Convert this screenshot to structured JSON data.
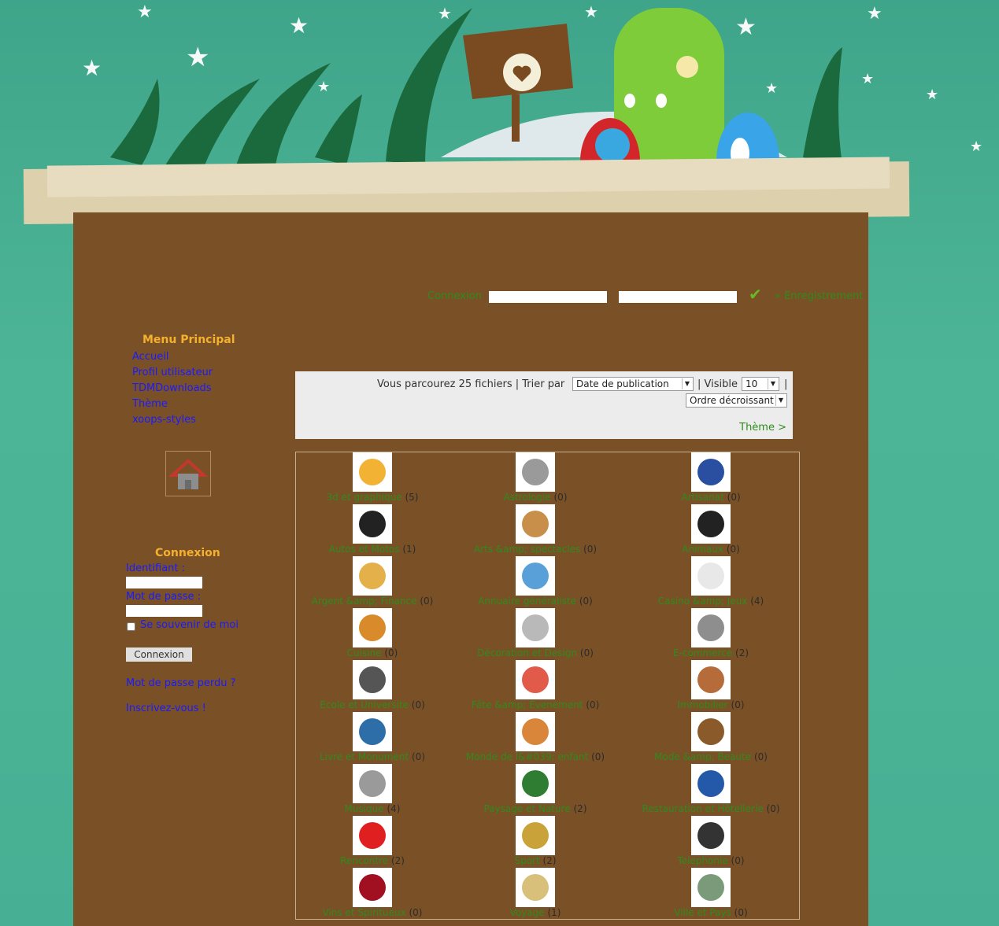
{
  "login_bar": {
    "label": "Connexion",
    "register": "» Enregistrement"
  },
  "menu": {
    "title": "Menu Principal",
    "items": [
      "Accueil",
      "Profil utilisateur",
      "TDMDownloads",
      "Thème",
      "xoops-styles"
    ]
  },
  "login_block": {
    "title": "Connexion",
    "username_label": "Identifiant :",
    "password_label": "Mot de passe :",
    "remember": "Se souvenir de moi",
    "submit": "Connexion",
    "lost_password": "Mot de passe perdu ?",
    "register": "Inscrivez-vous !"
  },
  "sort": {
    "summary": "Vous parcourez 25 fichiers | Trier par",
    "sort_by": "Date de publication",
    "visible_label": "| Visible",
    "visible_value": "10",
    "pipe": "|",
    "order": "Ordre décroissant",
    "theme_link": "Thème >"
  },
  "categories": [
    {
      "name": "3d et graphique",
      "count": "(5)",
      "icon": "pie-chart-icon"
    },
    {
      "name": "Astrologie",
      "count": "(0)",
      "icon": "crab-icon"
    },
    {
      "name": "Artisanat",
      "count": "(0)",
      "icon": "artisan-logo-icon"
    },
    {
      "name": "Autos et Motos",
      "count": "(1)",
      "icon": "motorbike-icon"
    },
    {
      "name": "Arts &amp; spectacles",
      "count": "(0)",
      "icon": "palette-icon"
    },
    {
      "name": "Animaux",
      "count": "(0)",
      "icon": "panda-icon"
    },
    {
      "name": "Argent &amp; Finance",
      "count": "(0)",
      "icon": "money-icon"
    },
    {
      "name": "Annuaire généraliste",
      "count": "(0)",
      "icon": "magnifier-icon"
    },
    {
      "name": "Casino &amp; Jeux",
      "count": "(4)",
      "icon": "cards-icon"
    },
    {
      "name": "Cuisine",
      "count": "(0)",
      "icon": "burger-icon"
    },
    {
      "name": "Décoration et Design",
      "count": "(0)",
      "icon": "design-chair-icon"
    },
    {
      "name": "E-commerce",
      "count": "(2)",
      "icon": "cart-icon"
    },
    {
      "name": "Ecole et Universite",
      "count": "(0)",
      "icon": "compass-icon"
    },
    {
      "name": "Fête &amp; Evenement",
      "count": "(0)",
      "icon": "party-hat-icon"
    },
    {
      "name": "Immobilier",
      "count": "(0)",
      "icon": "house-icon"
    },
    {
      "name": "Livre et Monument",
      "count": "(0)",
      "icon": "books-icon"
    },
    {
      "name": "Monde de l&#039; enfant",
      "count": "(0)",
      "icon": "child-icon"
    },
    {
      "name": "Mode &amp; Beaute",
      "count": "(0)",
      "icon": "boot-icon"
    },
    {
      "name": "Musique",
      "count": "(4)",
      "icon": "speaker-icon"
    },
    {
      "name": "Paysage et Nature",
      "count": "(2)",
      "icon": "tree-icon"
    },
    {
      "name": "Restauration et Hôtellerie",
      "count": "(0)",
      "icon": "restaurant-icon"
    },
    {
      "name": "Rencontre",
      "count": "(2)",
      "icon": "heart-icon"
    },
    {
      "name": "Sport",
      "count": "(2)",
      "icon": "trophy-icon"
    },
    {
      "name": "Telephonie",
      "count": "(0)",
      "icon": "phone-icon"
    },
    {
      "name": "Vins et Spiritueux",
      "count": "(0)",
      "icon": "wine-icon"
    },
    {
      "name": "Voyage",
      "count": "(1)",
      "icon": "plane-icon"
    },
    {
      "name": "Ville et Pays",
      "count": "(0)",
      "icon": "map-icon"
    }
  ],
  "colors": {
    "panel": "#7a5127",
    "link_green": "#2e8b1c",
    "link_blue": "#1a1aff",
    "title_orange": "#f5b02e"
  }
}
